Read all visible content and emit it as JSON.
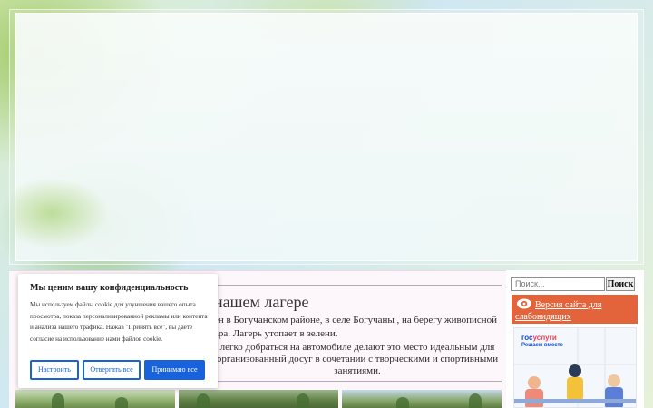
{
  "about": {
    "title": "нашем лагере",
    "paragraph1": "ен в Богучанском районе, в селе Богучаны , на берегу живописной ара. Лагерь утопает в зелени.",
    "paragraph2": "легко добраться на автомобиле делают это место идеальным для организованный досуг в сочетании с творческими и спортивными занятиями."
  },
  "sidebar": {
    "search_placeholder": "Поиск...",
    "search_button": "Поиск",
    "vision_link": "Версия сайта для слабовидящих",
    "gosuslugi_logo_main": "гос",
    "gosuslugi_logo_accent": "услуги",
    "gosuslugi_slogan": "Решаем вместе"
  },
  "cookie": {
    "title": "Мы ценим вашу конфиденциальность",
    "text": "Мы используем файлы cookie для улучшения вашего опыта просмотра, показа персонализированной рекламы или контента и анализа нашего трафика. Нажав \"Принять все\", вы даете согласие на использование нами файлов cookie.",
    "settings_button": "Настроить",
    "reject_button": "Отвергать все",
    "accept_button": "Принимаю все"
  },
  "colors": {
    "vision_bg": "#e3643b",
    "cookie_accent": "#1863dc",
    "gosuslugi_blue": "#0d4cd3",
    "gosuslugi_red": "#ee3f58"
  },
  "icons": {
    "vision": "eye-icon"
  }
}
